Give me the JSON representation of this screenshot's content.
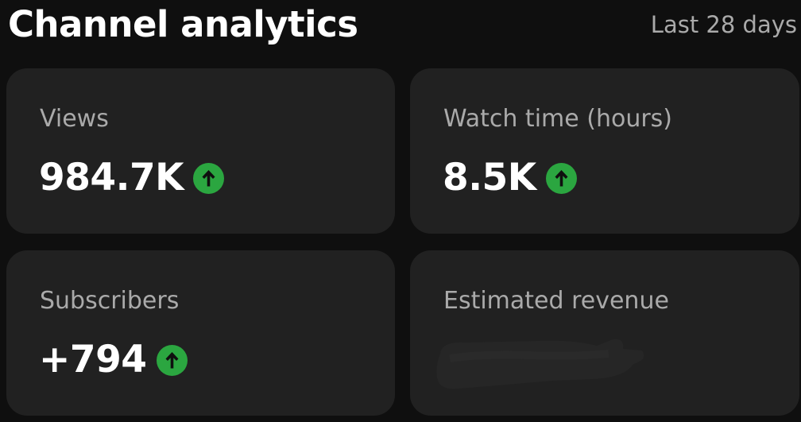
{
  "header": {
    "title": "Channel analytics",
    "range": "Last 28 days"
  },
  "cards": [
    {
      "label": "Views",
      "value": "984.7K",
      "trend": "up"
    },
    {
      "label": "Watch time (hours)",
      "value": "8.5K",
      "trend": "up"
    },
    {
      "label": "Subscribers",
      "value": "+794",
      "trend": "up"
    },
    {
      "label": "Estimated revenue",
      "value_redacted": true
    }
  ],
  "icons": {
    "trend_up": "arrow-up-circle-icon"
  },
  "colors": {
    "background": "#0f0f0f",
    "card": "#212121",
    "trend_up": "#2ba640",
    "label": "#aaaaaa"
  }
}
